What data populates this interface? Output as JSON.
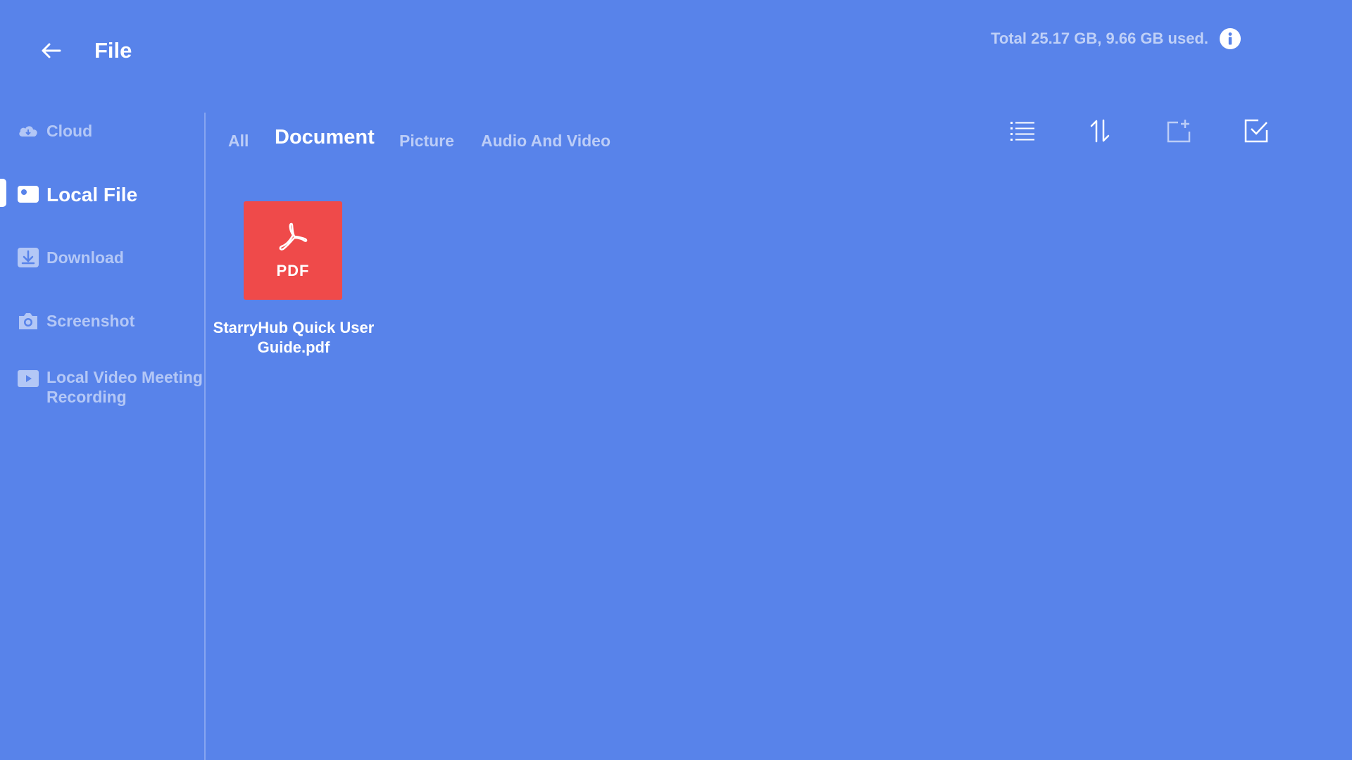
{
  "header": {
    "title": "File",
    "storage_text": "Total 25.17 GB, 9.66 GB used."
  },
  "sidebar": {
    "items": [
      {
        "label": "Cloud",
        "icon": "cloud-icon",
        "active": false
      },
      {
        "label": "Local File",
        "icon": "folder-icon",
        "active": true
      },
      {
        "label": "Download",
        "icon": "download-icon",
        "active": false
      },
      {
        "label": "Screenshot",
        "icon": "camera-icon",
        "active": false
      },
      {
        "label": "Local Video Meeting Recording",
        "icon": "video-icon",
        "active": false
      }
    ]
  },
  "tabs": [
    {
      "label": "All",
      "active": false
    },
    {
      "label": "Document",
      "active": true
    },
    {
      "label": "Picture",
      "active": false
    },
    {
      "label": "Audio And Video",
      "active": false
    }
  ],
  "toolbar": {
    "icons": [
      "list-view-icon",
      "sort-icon",
      "new-folder-icon",
      "select-icon"
    ]
  },
  "files": [
    {
      "type_label": "PDF",
      "name": "StarryHub Quick User Guide.pdf"
    }
  ],
  "colors": {
    "background": "#5883ea",
    "pdf_thumb": "#ef4a4a",
    "active_text": "#ffffff"
  }
}
